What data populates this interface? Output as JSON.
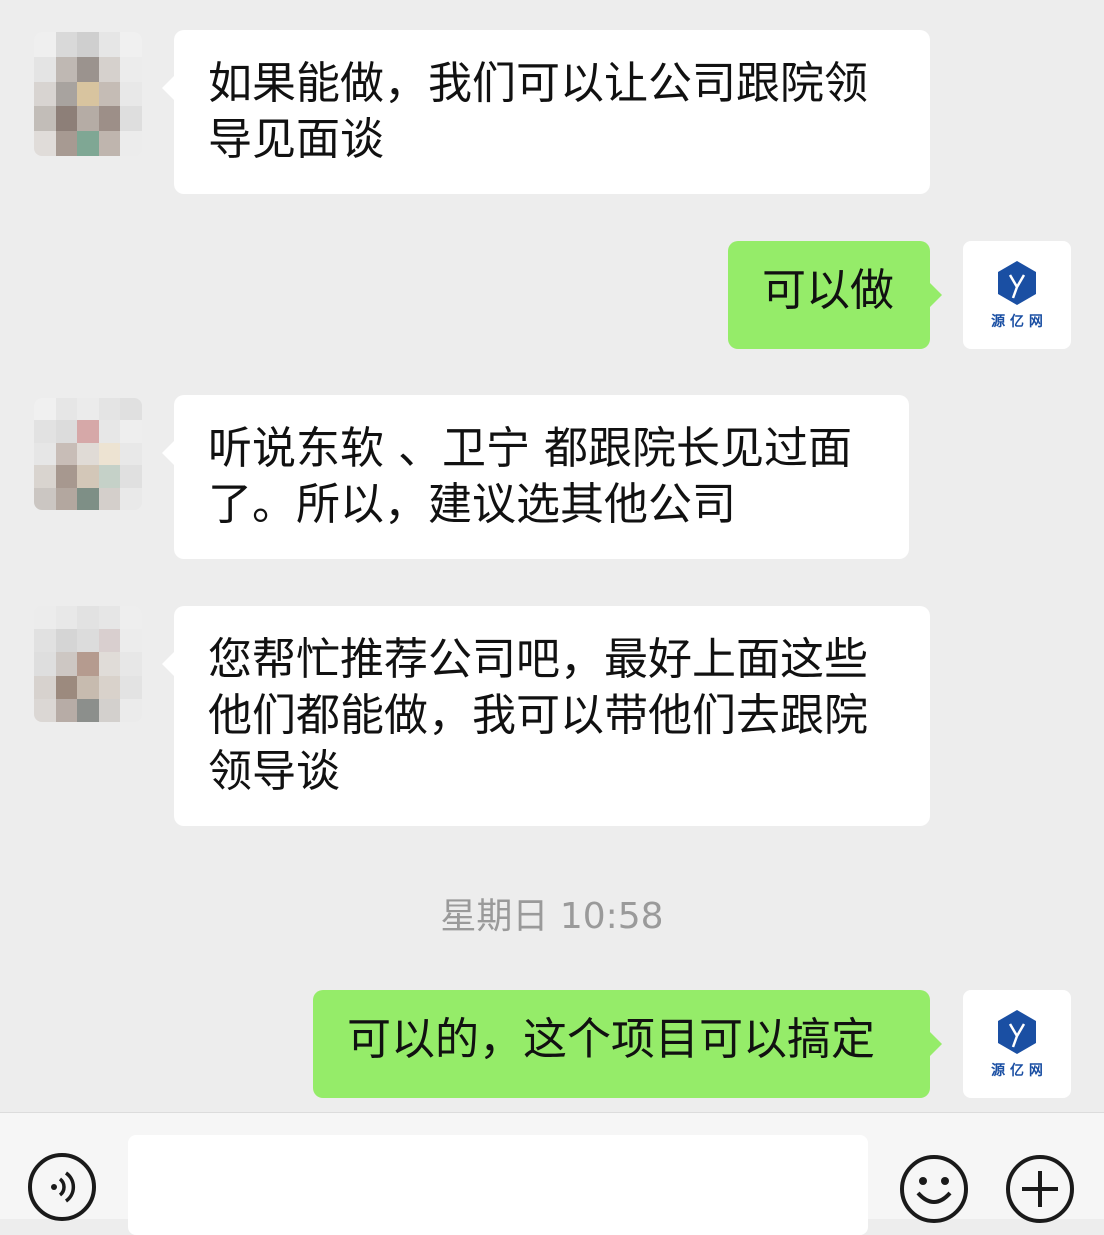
{
  "messages": [
    {
      "direction": "in",
      "text": "如果能做，我们可以让公司跟院领导见面谈"
    },
    {
      "direction": "out",
      "text": "可以做"
    },
    {
      "direction": "in",
      "text": "听说东软 、卫宁 都跟院长见过面了。所以，建议选其他公司"
    },
    {
      "direction": "in",
      "text": "您帮忙推荐公司吧，最好上面这些他们都能做，我可以带他们去跟院领导谈"
    },
    {
      "direction": "out",
      "text": "可以的，这个项目可以搞定"
    }
  ],
  "timestamp": "星期日 10:58",
  "my_avatar": {
    "logo_text": "源 亿 网",
    "logo_color": "#1a4fa3"
  },
  "input_bar": {
    "voice_icon": "voice-icon",
    "emoji_icon": "emoji-icon",
    "plus_icon": "plus-icon",
    "placeholder": ""
  },
  "colors": {
    "background": "#ededed",
    "incoming_bubble": "#ffffff",
    "outgoing_bubble": "#95ec69",
    "timestamp": "#9a9a9a"
  }
}
